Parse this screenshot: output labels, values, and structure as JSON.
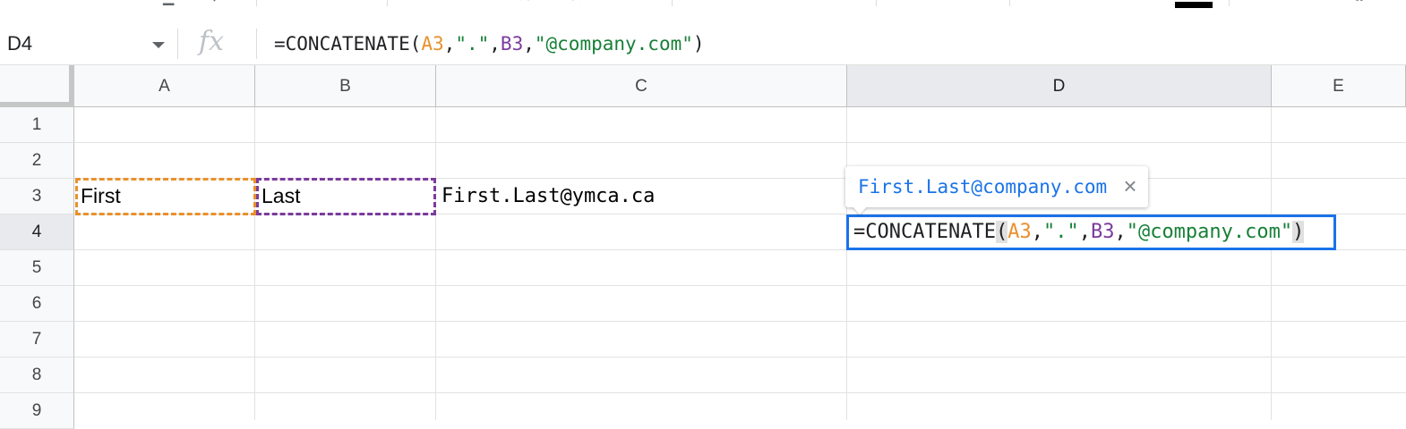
{
  "formula_bar": {
    "name_box": "D4",
    "fx_label": "fx",
    "formula": {
      "prefix": "=CONCATENATE(",
      "ref1": "A3",
      "sep1": ",",
      "str1": "\".\"",
      "sep2": ",",
      "ref2": "B3",
      "sep3": ",",
      "str2": "\"@company.com\"",
      "suffix": ")"
    }
  },
  "columns": [
    "A",
    "B",
    "C",
    "D",
    "E"
  ],
  "active_column": "D",
  "rows": [
    "1",
    "2",
    "3",
    "4",
    "5",
    "6",
    "7",
    "8",
    "9"
  ],
  "active_row": "4",
  "cells": {
    "A3": "First",
    "B3": "Last",
    "C3": "First.Last@ymca.ca"
  },
  "edit_cell": {
    "address": "D4",
    "prefix": "=CONCATENATE",
    "open_paren": "(",
    "ref1": "A3",
    "sep1": ",",
    "str1": "\".\"",
    "sep2": ",",
    "ref2": "B3",
    "sep3": ",",
    "str2": "\"@company.com\"",
    "close_paren": ")"
  },
  "tooltip": {
    "preview": "First.Last@company.com",
    "close_glyph": "×"
  },
  "colors": {
    "ref_a": "#e8912d",
    "ref_b": "#7b3b9d",
    "string": "#188038",
    "selection": "#1a73e8"
  },
  "icons": [
    "function-icon",
    "dropdown-arrow-icon",
    "close-icon"
  ]
}
